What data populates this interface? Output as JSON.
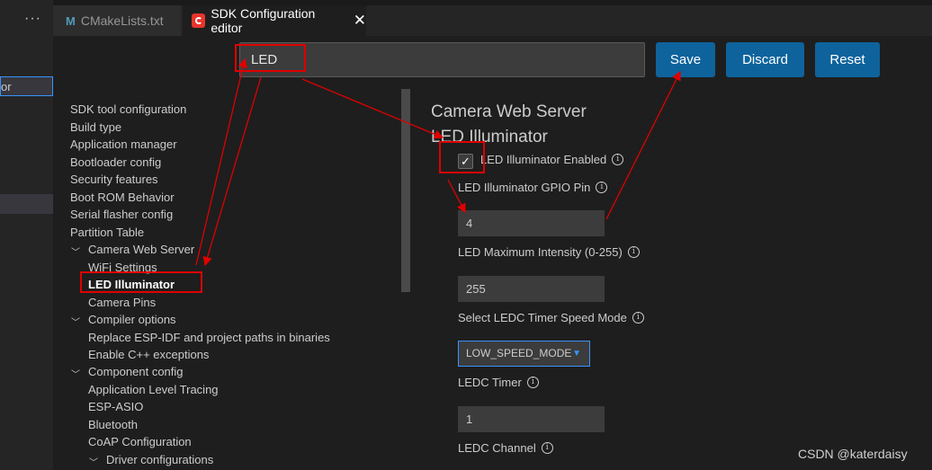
{
  "sidebar": {
    "partial_label": "or"
  },
  "tabs": [
    {
      "label": "CMakeLists.txt",
      "icon": "cmake-m-icon"
    },
    {
      "label": "SDK Configuration editor",
      "icon": "espressif-icon"
    }
  ],
  "search": {
    "value": "LED"
  },
  "buttons": {
    "save": "Save",
    "discard": "Discard",
    "reset": "Reset"
  },
  "tree": [
    {
      "label": "SDK tool configuration"
    },
    {
      "label": "Build type"
    },
    {
      "label": "Application manager"
    },
    {
      "label": "Bootloader config"
    },
    {
      "label": "Security features"
    },
    {
      "label": "Boot ROM Behavior"
    },
    {
      "label": "Serial flasher config"
    },
    {
      "label": "Partition Table"
    },
    {
      "label": "Camera Web Server"
    },
    {
      "label": "WiFi Settings"
    },
    {
      "label": "LED Illuminator"
    },
    {
      "label": "Camera Pins"
    },
    {
      "label": "Compiler options"
    },
    {
      "label": "Replace ESP-IDF and project paths in binaries"
    },
    {
      "label": "Enable C++ exceptions"
    },
    {
      "label": "Component config"
    },
    {
      "label": "Application Level Tracing"
    },
    {
      "label": "ESP-ASIO"
    },
    {
      "label": "Bluetooth"
    },
    {
      "label": "CoAP Configuration"
    },
    {
      "label": "Driver configurations"
    }
  ],
  "content": {
    "section_title": "Camera Web Server",
    "subsection_title": "LED Illuminator",
    "enabled_label": "LED Illuminator Enabled",
    "enabled_checked": true,
    "gpio_label": "LED Illuminator GPIO Pin",
    "gpio_value": "4",
    "intensity_label": "LED Maximum Intensity (0-255)",
    "intensity_value": "255",
    "timer_speed_label": "Select LEDC Timer Speed Mode",
    "timer_speed_value": "LOW_SPEED_MODE",
    "timer_label": "LEDC Timer",
    "timer_value": "1",
    "channel_label": "LEDC Channel"
  },
  "watermark": "CSDN @katerdaisy",
  "colors": {
    "button": "#0e639c",
    "annotation": "#e00000",
    "focus": "#3794ff"
  }
}
